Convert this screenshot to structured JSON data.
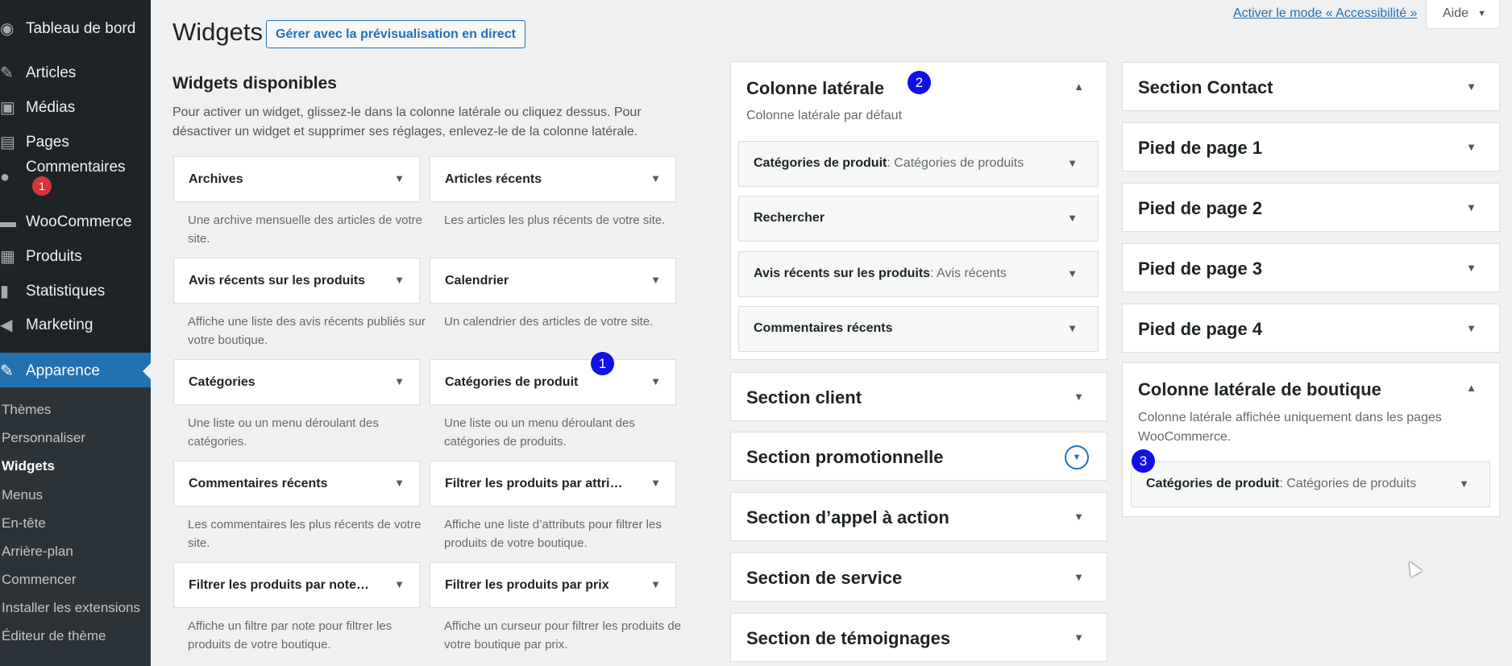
{
  "sidebar": {
    "items": [
      {
        "label": "Tableau de bord",
        "icon": "dashboard-icon",
        "glyph": "◉"
      },
      {
        "label": "Articles",
        "icon": "pushpin-icon",
        "glyph": "✎"
      },
      {
        "label": "Médias",
        "icon": "media-icon",
        "glyph": "▣"
      },
      {
        "label": "Pages",
        "icon": "pages-icon",
        "glyph": "▤"
      },
      {
        "label": "Commentaires",
        "icon": "comments-icon",
        "glyph": "●",
        "badge": "1"
      },
      {
        "label": "WooCommerce",
        "icon": "woocommerce-icon",
        "glyph": "▬"
      },
      {
        "label": "Produits",
        "icon": "products-icon",
        "glyph": "▦"
      },
      {
        "label": "Statistiques",
        "icon": "stats-icon",
        "glyph": "▮"
      },
      {
        "label": "Marketing",
        "icon": "megaphone-icon",
        "glyph": "◀"
      },
      {
        "label": "Apparence",
        "icon": "appearance-icon",
        "glyph": "✎"
      }
    ],
    "submenu": [
      "Thèmes",
      "Personnaliser",
      "Widgets",
      "Menus",
      "En-tête",
      "Arrière-plan",
      "Commencer",
      "Installer les extensions",
      "Éditeur de thème"
    ]
  },
  "header": {
    "title": "Widgets",
    "live_preview_label": "Gérer avec la prévisualisation en direct",
    "accessibility_link": "Activer le mode « Accessibilité »",
    "help_label": "Aide"
  },
  "available": {
    "title": "Widgets disponibles",
    "description": "Pour activer un widget, glissez-le dans la colonne latérale ou cliquez dessus. Pour désactiver un widget et supprimer ses réglages, enlevez-le de la colonne latérale.",
    "widgets": [
      {
        "title": "Archives",
        "desc": "Une archive mensuelle des articles de votre site."
      },
      {
        "title": "Articles récents",
        "desc": "Les articles les plus récents de votre site."
      },
      {
        "title": "Avis récents sur les produits",
        "desc": "Affiche une liste des avis récents publiés sur votre boutique."
      },
      {
        "title": "Calendrier",
        "desc": "Un calendrier des articles de votre site."
      },
      {
        "title": "Catégories",
        "desc": "Une liste ou un menu déroulant des catégories."
      },
      {
        "title": "Catégories de produit",
        "desc": "Une liste ou un menu déroulant des catégories de produits."
      },
      {
        "title": "Commentaires récents",
        "desc": "Les commentaires les plus récents de votre site."
      },
      {
        "title": "Filtrer les produits par attri…",
        "desc": "Affiche une liste d’attributs pour filtrer les produits de votre boutique."
      },
      {
        "title": "Filtrer les produits par note…",
        "desc": "Affiche un filtre par note pour filtrer les produits de votre boutique."
      },
      {
        "title": "Filtrer les produits par prix",
        "desc": "Affiche un curseur pour filtrer les produits de votre boutique par prix."
      }
    ]
  },
  "sidebar_area": {
    "title": "Colonne latérale",
    "description": "Colonne latérale par défaut",
    "widgets": [
      {
        "title": "Catégories de produit",
        "sub": ": Catégories de produits"
      },
      {
        "title": "Rechercher",
        "sub": ""
      },
      {
        "title": "Avis récents sur les produits",
        "sub": ": Avis récents"
      },
      {
        "title": "Commentaires récents",
        "sub": ""
      }
    ]
  },
  "middle_areas": [
    "Section client",
    "Section promotionnelle",
    "Section d’appel à action",
    "Section de service",
    "Section de témoignages"
  ],
  "right_areas": [
    "Section Contact",
    "Pied de page 1",
    "Pied de page 2",
    "Pied de page 3",
    "Pied de page 4"
  ],
  "shop_area": {
    "title": "Colonne latérale de boutique",
    "description": "Colonne latérale affichée uniquement dans les pages WooCommerce.",
    "widget_title": "Catégories de produit",
    "widget_sub": ": Catégories de produits"
  },
  "markers": [
    "1",
    "2",
    "3"
  ],
  "colors": {
    "accent": "#2271b1",
    "sidebar_bg": "#1d2327",
    "badge": "#d63638",
    "marker": "#1010e8"
  }
}
